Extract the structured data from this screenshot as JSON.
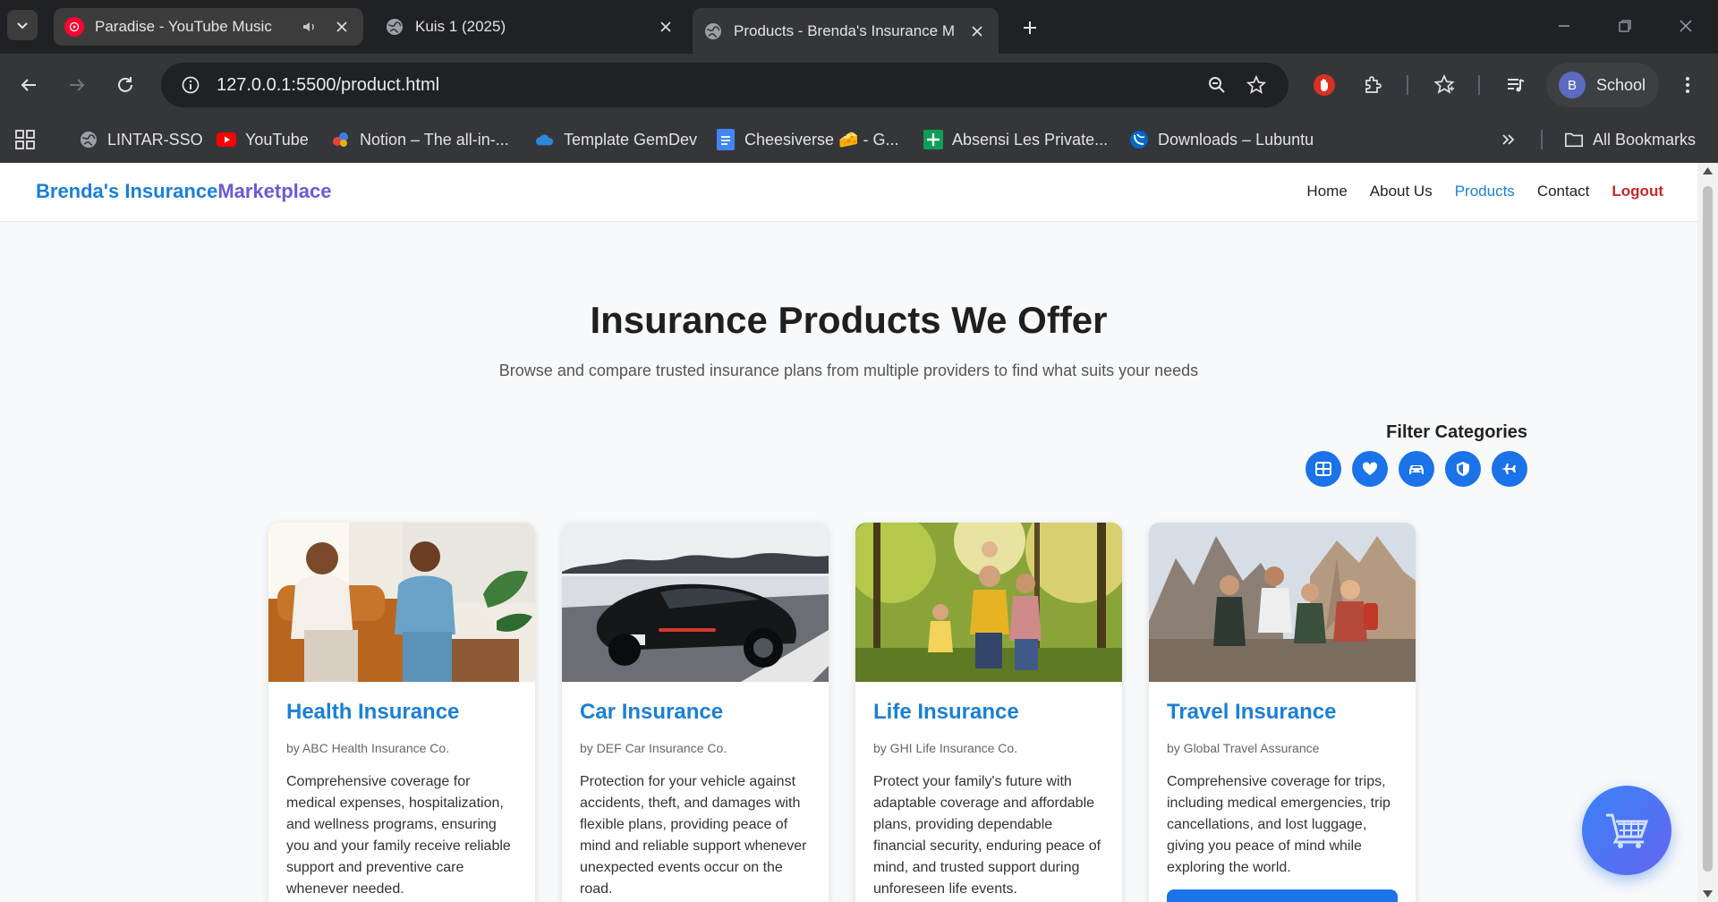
{
  "browser": {
    "tabs": [
      {
        "title": "Paradise - YouTube Music",
        "favicon": "youtube-music-icon",
        "audio": true,
        "active": false
      },
      {
        "title": "Kuis 1 (2025)",
        "favicon": "globe-icon",
        "audio": false,
        "active": false
      },
      {
        "title": "Products - Brenda's Insurance M",
        "favicon": "globe-icon",
        "audio": false,
        "active": true
      }
    ],
    "url": "127.0.0.1:5500/product.html",
    "profile": {
      "initial": "B",
      "name": "School"
    },
    "bookmarks": [
      {
        "label": "LINTAR-SSO",
        "icon": "globe-icon"
      },
      {
        "label": "YouTube",
        "icon": "youtube-icon"
      },
      {
        "label": "Notion – The all-in-...",
        "icon": "notion-icon"
      },
      {
        "label": "Template GemDev",
        "icon": "cloud-icon"
      },
      {
        "label": "Cheesiverse 🧀 - G...",
        "icon": "docs-icon"
      },
      {
        "label": "Absensi Les Private...",
        "icon": "sheets-icon"
      },
      {
        "label": "Downloads – Lubuntu",
        "icon": "lubuntu-icon"
      }
    ],
    "all_bookmarks_label": "All Bookmarks"
  },
  "site": {
    "logo_part1": "Brenda's Insurance",
    "logo_part2": "Marketplace",
    "nav": {
      "home": "Home",
      "about": "About Us",
      "products": "Products",
      "contact": "Contact",
      "logout": "Logout"
    }
  },
  "hero": {
    "title": "Insurance Products We Offer",
    "subtitle": "Browse and compare trusted insurance plans from multiple providers to find what suits your needs"
  },
  "filters": {
    "title": "Filter Categories",
    "buttons": [
      "grid-icon",
      "heart-icon",
      "car-icon",
      "shield-icon",
      "plane-icon"
    ]
  },
  "products": [
    {
      "name": "Health Insurance",
      "provider": "by ABC Health Insurance Co.",
      "description": "Comprehensive coverage for medical expenses, hospitalization, and wellness programs, ensuring you and your family receive reliable support and preventive care whenever needed."
    },
    {
      "name": "Car Insurance",
      "provider": "by DEF Car Insurance Co.",
      "description": "Protection for your vehicle against accidents, theft, and damages with flexible plans, providing peace of mind and reliable support whenever unexpected events occur on the road."
    },
    {
      "name": "Life Insurance",
      "provider": "by GHI Life Insurance Co.",
      "description": "Protect your family's future with adaptable coverage and affordable plans, providing dependable financial security, enduring peace of mind, and trusted support during unforeseen life events."
    },
    {
      "name": "Travel Insurance",
      "provider": "by Global Travel Assurance",
      "description": "Comprehensive coverage for trips, including medical emergencies, trip cancellations, and lost luggage, giving you peace of mind while exploring the world."
    }
  ],
  "colors": {
    "accent": "#1a7fd6",
    "logout": "#c62828",
    "button": "#1a73e8"
  }
}
